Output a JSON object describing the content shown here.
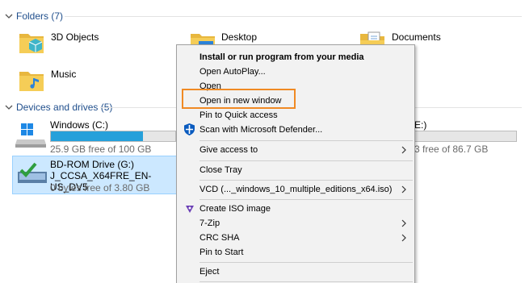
{
  "sections": {
    "folders": "Folders (7)",
    "devices": "Devices and drives (5)"
  },
  "folders": {
    "objects3d": "3D Objects",
    "desktop": "Desktop",
    "documents": "Documents",
    "music": "Music"
  },
  "drives": {
    "windows": {
      "name": "Windows (C:)",
      "free": "25.9 GB free of 100 GB",
      "used_fraction": 0.74
    },
    "other": {
      "name_fragment": "E:)",
      "free_fragment": "3 free of 86.7 GB",
      "used_fraction": 0.0
    },
    "bdrom": {
      "name": "BD-ROM Drive (G:)",
      "label": "J_CCSA_X64FRE_EN-US_DV5",
      "free": "0 bytes free of 3.80 GB"
    }
  },
  "context_menu": {
    "install": "Install or run program from your media",
    "autoplay": "Open AutoPlay...",
    "open": "Open",
    "open_new_window": "Open in new window",
    "pin_quick": "Pin to Quick access",
    "scan_defender": "Scan with Microsoft Defender...",
    "give_access": "Give access to",
    "close_tray": "Close Tray",
    "vcd": "VCD (..._windows_10_multiple_editions_x64.iso)",
    "create_iso": "Create ISO image",
    "zip": "7-Zip",
    "crc": "CRC SHA",
    "pin_start": "Pin to Start",
    "eject": "Eject"
  },
  "colors": {
    "accent": "#26a0da",
    "highlight_box": "#f08a24",
    "selection": "#cce8ff",
    "header_text": "#1f4e8c"
  }
}
